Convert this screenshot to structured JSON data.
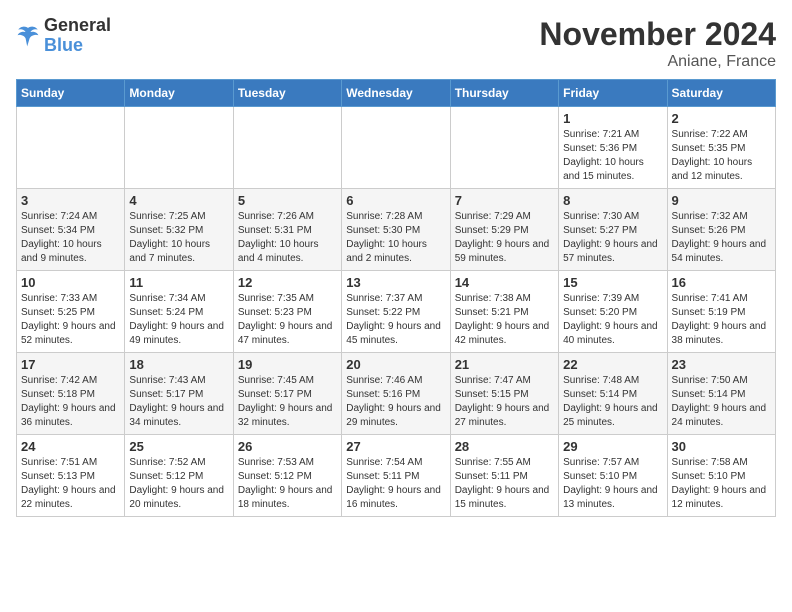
{
  "logo": {
    "line1": "General",
    "line2": "Blue"
  },
  "title": "November 2024",
  "location": "Aniane, France",
  "days_of_week": [
    "Sunday",
    "Monday",
    "Tuesday",
    "Wednesday",
    "Thursday",
    "Friday",
    "Saturday"
  ],
  "weeks": [
    [
      {
        "num": "",
        "info": ""
      },
      {
        "num": "",
        "info": ""
      },
      {
        "num": "",
        "info": ""
      },
      {
        "num": "",
        "info": ""
      },
      {
        "num": "",
        "info": ""
      },
      {
        "num": "1",
        "info": "Sunrise: 7:21 AM\nSunset: 5:36 PM\nDaylight: 10 hours and 15 minutes."
      },
      {
        "num": "2",
        "info": "Sunrise: 7:22 AM\nSunset: 5:35 PM\nDaylight: 10 hours and 12 minutes."
      }
    ],
    [
      {
        "num": "3",
        "info": "Sunrise: 7:24 AM\nSunset: 5:34 PM\nDaylight: 10 hours and 9 minutes."
      },
      {
        "num": "4",
        "info": "Sunrise: 7:25 AM\nSunset: 5:32 PM\nDaylight: 10 hours and 7 minutes."
      },
      {
        "num": "5",
        "info": "Sunrise: 7:26 AM\nSunset: 5:31 PM\nDaylight: 10 hours and 4 minutes."
      },
      {
        "num": "6",
        "info": "Sunrise: 7:28 AM\nSunset: 5:30 PM\nDaylight: 10 hours and 2 minutes."
      },
      {
        "num": "7",
        "info": "Sunrise: 7:29 AM\nSunset: 5:29 PM\nDaylight: 9 hours and 59 minutes."
      },
      {
        "num": "8",
        "info": "Sunrise: 7:30 AM\nSunset: 5:27 PM\nDaylight: 9 hours and 57 minutes."
      },
      {
        "num": "9",
        "info": "Sunrise: 7:32 AM\nSunset: 5:26 PM\nDaylight: 9 hours and 54 minutes."
      }
    ],
    [
      {
        "num": "10",
        "info": "Sunrise: 7:33 AM\nSunset: 5:25 PM\nDaylight: 9 hours and 52 minutes."
      },
      {
        "num": "11",
        "info": "Sunrise: 7:34 AM\nSunset: 5:24 PM\nDaylight: 9 hours and 49 minutes."
      },
      {
        "num": "12",
        "info": "Sunrise: 7:35 AM\nSunset: 5:23 PM\nDaylight: 9 hours and 47 minutes."
      },
      {
        "num": "13",
        "info": "Sunrise: 7:37 AM\nSunset: 5:22 PM\nDaylight: 9 hours and 45 minutes."
      },
      {
        "num": "14",
        "info": "Sunrise: 7:38 AM\nSunset: 5:21 PM\nDaylight: 9 hours and 42 minutes."
      },
      {
        "num": "15",
        "info": "Sunrise: 7:39 AM\nSunset: 5:20 PM\nDaylight: 9 hours and 40 minutes."
      },
      {
        "num": "16",
        "info": "Sunrise: 7:41 AM\nSunset: 5:19 PM\nDaylight: 9 hours and 38 minutes."
      }
    ],
    [
      {
        "num": "17",
        "info": "Sunrise: 7:42 AM\nSunset: 5:18 PM\nDaylight: 9 hours and 36 minutes."
      },
      {
        "num": "18",
        "info": "Sunrise: 7:43 AM\nSunset: 5:17 PM\nDaylight: 9 hours and 34 minutes."
      },
      {
        "num": "19",
        "info": "Sunrise: 7:45 AM\nSunset: 5:17 PM\nDaylight: 9 hours and 32 minutes."
      },
      {
        "num": "20",
        "info": "Sunrise: 7:46 AM\nSunset: 5:16 PM\nDaylight: 9 hours and 29 minutes."
      },
      {
        "num": "21",
        "info": "Sunrise: 7:47 AM\nSunset: 5:15 PM\nDaylight: 9 hours and 27 minutes."
      },
      {
        "num": "22",
        "info": "Sunrise: 7:48 AM\nSunset: 5:14 PM\nDaylight: 9 hours and 25 minutes."
      },
      {
        "num": "23",
        "info": "Sunrise: 7:50 AM\nSunset: 5:14 PM\nDaylight: 9 hours and 24 minutes."
      }
    ],
    [
      {
        "num": "24",
        "info": "Sunrise: 7:51 AM\nSunset: 5:13 PM\nDaylight: 9 hours and 22 minutes."
      },
      {
        "num": "25",
        "info": "Sunrise: 7:52 AM\nSunset: 5:12 PM\nDaylight: 9 hours and 20 minutes."
      },
      {
        "num": "26",
        "info": "Sunrise: 7:53 AM\nSunset: 5:12 PM\nDaylight: 9 hours and 18 minutes."
      },
      {
        "num": "27",
        "info": "Sunrise: 7:54 AM\nSunset: 5:11 PM\nDaylight: 9 hours and 16 minutes."
      },
      {
        "num": "28",
        "info": "Sunrise: 7:55 AM\nSunset: 5:11 PM\nDaylight: 9 hours and 15 minutes."
      },
      {
        "num": "29",
        "info": "Sunrise: 7:57 AM\nSunset: 5:10 PM\nDaylight: 9 hours and 13 minutes."
      },
      {
        "num": "30",
        "info": "Sunrise: 7:58 AM\nSunset: 5:10 PM\nDaylight: 9 hours and 12 minutes."
      }
    ]
  ]
}
